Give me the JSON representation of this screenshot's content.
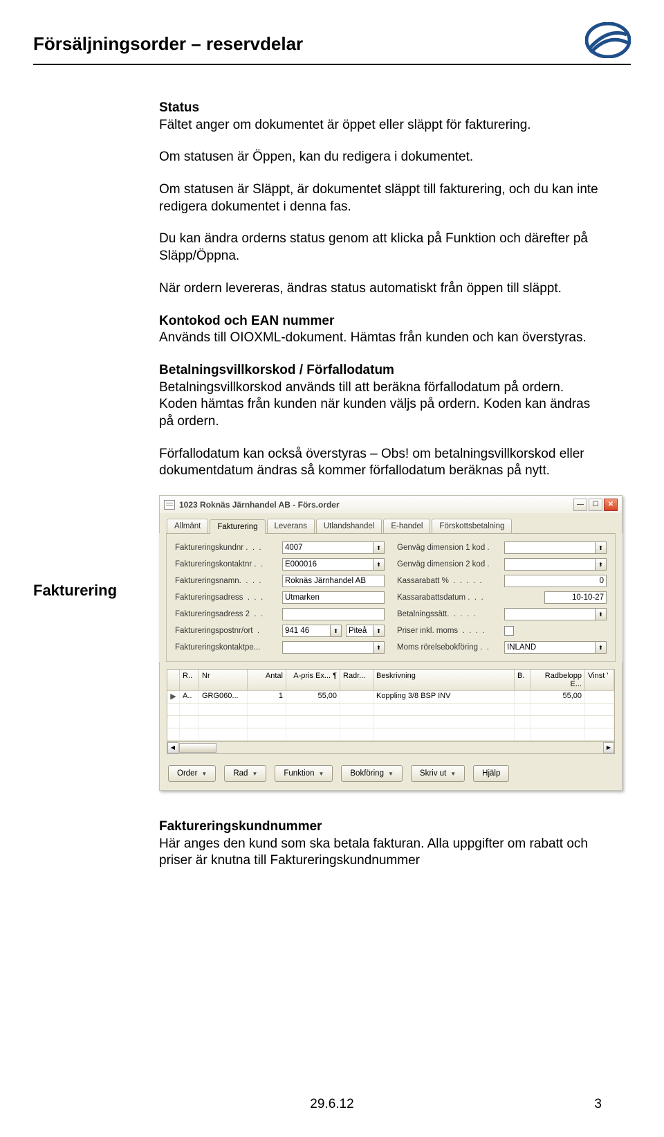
{
  "header": {
    "title": "Försäljningsorder – reservdelar"
  },
  "body": {
    "h1": "Status",
    "p1": "Fältet anger om dokumentet är öppet eller släppt för fakturering.",
    "p2": "Om statusen är Öppen, kan du redigera i dokumentet.",
    "p3": "Om statusen är Släppt, är dokumentet släppt till fakturering, och du kan inte redigera dokumentet i denna fas.",
    "p4": "Du kan ändra orderns status genom att klicka på Funktion och därefter på Släpp/Öppna.",
    "p5": "När ordern levereras, ändras status automatiskt från öppen till släppt.",
    "h2": "Kontokod och EAN nummer",
    "p6": "Används till OIOXML-dokument. Hämtas från kunden och kan överstyras.",
    "h3": "Betalningsvillkorskod / Förfallodatum",
    "p7": "Betalningsvillkorskod används till att beräkna förfallodatum på ordern. Koden hämtas från kunden när kunden väljs på ordern. Koden kan ändras på ordern.",
    "p8": "Förfallodatum kan också överstyras – Obs! om betalningsvillkorskod eller dokumentdatum ändras så kommer förfallodatum beräknas på nytt."
  },
  "section_label": "Fakturering",
  "win": {
    "title": "1023 Roknäs Järnhandel AB - Förs.order",
    "tabs": [
      "Allmänt",
      "Fakturering",
      "Leverans",
      "Utlandshandel",
      "E-handel",
      "Förskottsbetalning"
    ],
    "active_tab": 1,
    "left": [
      {
        "label": "Faktureringskundnr .  .  .",
        "value": "4007",
        "lookup": true
      },
      {
        "label": "Faktureringskontaktnr .  .",
        "value": "E000016",
        "lookup": true
      },
      {
        "label": "Faktureringsnamn.  .  .  .",
        "value": "Roknäs Järnhandel AB"
      },
      {
        "label": "Faktureringsadress  .  .  .",
        "value": "Utmarken"
      },
      {
        "label": "Faktureringsadress 2  .  .",
        "value": ""
      },
      {
        "label": "Faktureringspostnr/ort  .",
        "value": "941 46",
        "city": "Piteå",
        "split": true
      },
      {
        "label": "Faktureringskontaktpe...",
        "value": "",
        "lookup": true
      }
    ],
    "right": [
      {
        "label": "Genväg dimension 1 kod .",
        "value": "",
        "lookup": true
      },
      {
        "label": "Genväg dimension 2 kod .",
        "value": "",
        "lookup": true
      },
      {
        "label": "Kassarabatt %  .  .  .  .  .",
        "value": "0",
        "align": "right"
      },
      {
        "label": "Kassarabattsdatum .  .  .",
        "value": "10-10-27",
        "date": true
      },
      {
        "label": "Betalningssätt.  .  .  .  .",
        "value": "",
        "lookup": true
      },
      {
        "label": "Priser inkl. moms  .  .  .  .",
        "value": "",
        "check": true
      },
      {
        "label": "Moms rörelsebokföring .  .",
        "value": "INLAND",
        "lookup": true
      }
    ],
    "grid": {
      "cols": [
        "",
        "R..",
        "Nr",
        "Antal",
        "A-pris Ex... ¶",
        "Radr...",
        "Beskrivning",
        "B.",
        "Radbelopp E...",
        "Vinst '"
      ],
      "row": [
        "▶",
        "A..",
        "GRG060...",
        "1",
        "55,00",
        "",
        "Koppling 3/8 BSP INV",
        "",
        "55,00",
        ""
      ]
    },
    "buttons": [
      "Order",
      "Rad",
      "Funktion",
      "Bokföring",
      "Skriv ut",
      "Hjälp"
    ]
  },
  "after": {
    "h": "Faktureringskundnummer",
    "p": "Här anges den kund som ska betala fakturan. Alla uppgifter om rabatt och priser är knutna till Faktureringskundnummer"
  },
  "footer": {
    "date": "29.6.12",
    "page": "3"
  }
}
